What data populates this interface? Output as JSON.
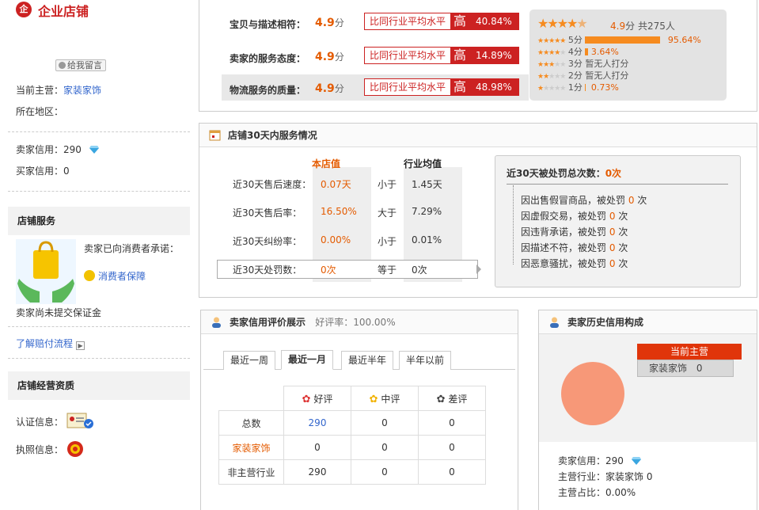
{
  "shop": {
    "logo_text": "企",
    "title": "企业店铺",
    "message_btn": "给我留言",
    "main_label": "当前主营：",
    "main_value": "家装家饰",
    "region_label": "所在地区：",
    "region_value": "",
    "seller_credit_label": "卖家信用：",
    "seller_credit_value": "290",
    "buyer_credit_label": "买家信用：",
    "buyer_credit_value": "0"
  },
  "service": {
    "title": "店铺服务",
    "promise": "卖家已向消费者承诺：",
    "guarantee": "消费者保障",
    "deposit": "卖家尚未提交保证金",
    "flow_link": "了解赔付流程"
  },
  "qualification": {
    "title": "店铺经营资质",
    "cert_label": "认证信息：",
    "license_label": "执照信息："
  },
  "dsr": {
    "rows": [
      {
        "label": "宝贝与描述相符：",
        "score": "4.9",
        "unit": "分",
        "compare": "比同行业平均水平",
        "level": "高",
        "percent": "40.84%"
      },
      {
        "label": "卖家的服务态度：",
        "score": "4.9",
        "unit": "分",
        "compare": "比同行业平均水平",
        "level": "高",
        "percent": "14.89%"
      },
      {
        "label": "物流服务的质量：",
        "score": "4.9",
        "unit": "分",
        "compare": "比同行业平均水平",
        "level": "高",
        "percent": "48.98%"
      }
    ],
    "summary_score": "4.9",
    "summary_unit": "分",
    "summary_count": "共275人",
    "summary_stars": 4.5,
    "dist": [
      {
        "stars": 5,
        "label": "5分",
        "value": "95.64%",
        "fraction": 0.9564
      },
      {
        "stars": 4,
        "label": "4分",
        "value": "3.64%",
        "fraction": 0.0364
      },
      {
        "stars": 3,
        "label": "3分",
        "value": "暂无人打分",
        "fraction": 0
      },
      {
        "stars": 2,
        "label": "2分",
        "value": "暂无人打分",
        "fraction": 0
      },
      {
        "stars": 1,
        "label": "1分",
        "value": "0.73%",
        "fraction": 0.0073
      }
    ]
  },
  "svc30": {
    "title": "店铺30天内服务情况",
    "col_store": "本店值",
    "col_industry": "行业均值",
    "rows": [
      {
        "label": "近30天售后速度：",
        "store": "0.07天",
        "cmp": "小于",
        "industry": "1.45天"
      },
      {
        "label": "近30天售后率：",
        "store": "16.50%",
        "cmp": "大于",
        "industry": "7.29%"
      },
      {
        "label": "近30天纠纷率：",
        "store": "0.00%",
        "cmp": "小于",
        "industry": "0.01%"
      },
      {
        "label": "近30天处罚数：",
        "store": "0次",
        "cmp": "等于",
        "industry": "0次"
      }
    ],
    "penalty_title": "近30天被处罚总次数：",
    "penalty_total": "0次",
    "penalties": [
      {
        "text": "因出售假冒商品，被处罚",
        "count": "0",
        "unit": "次"
      },
      {
        "text": "因虚假交易，被处罚",
        "count": "0",
        "unit": "次"
      },
      {
        "text": "因违背承诺，被处罚",
        "count": "0",
        "unit": "次"
      },
      {
        "text": "因描述不符，被处罚",
        "count": "0",
        "unit": "次"
      },
      {
        "text": "因恶意骚扰，被处罚",
        "count": "0",
        "unit": "次"
      }
    ]
  },
  "credit": {
    "title": "卖家信用评价展示",
    "rate_label": "好评率：100.00%",
    "tabs": [
      "最近一周",
      "最近一月",
      "最近半年",
      "半年以前"
    ],
    "headers": [
      "好评",
      "中评",
      "差评"
    ],
    "rows": [
      {
        "label": "总数",
        "good": "290",
        "mid": "0",
        "bad": "0"
      },
      {
        "label": "家装家饰",
        "good": "0",
        "mid": "0",
        "bad": "0"
      },
      {
        "label": "非主营行业",
        "good": "290",
        "mid": "0",
        "bad": "0"
      }
    ]
  },
  "history": {
    "title": "卖家历史信用构成",
    "flag": "当前主营",
    "cat_name": "家装家饰",
    "cat_value": "0",
    "seller_credit_label": "卖家信用：",
    "seller_credit_value": "290",
    "main_industry_label": "主营行业：",
    "main_industry_value": "家装家饰 0",
    "main_ratio_label": "主营占比：",
    "main_ratio_value": "0.00%",
    "pie_color": "#f79878"
  }
}
